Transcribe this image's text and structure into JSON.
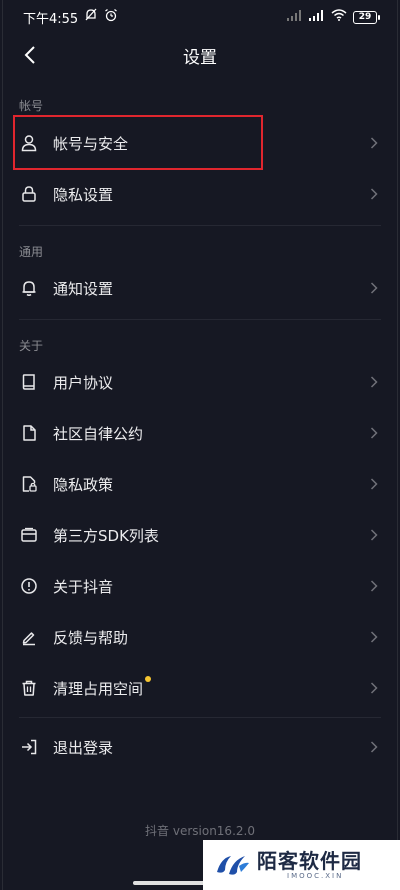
{
  "status_bar": {
    "time": "下午4:55",
    "battery": "29"
  },
  "nav": {
    "title": "设置"
  },
  "sections": {
    "account": {
      "header": "帐号",
      "items": [
        {
          "label": "帐号与安全"
        },
        {
          "label": "隐私设置"
        }
      ]
    },
    "general": {
      "header": "通用",
      "items": [
        {
          "label": "通知设置"
        }
      ]
    },
    "about": {
      "header": "关于",
      "items": [
        {
          "label": "用户协议"
        },
        {
          "label": "社区自律公约"
        },
        {
          "label": "隐私政策"
        },
        {
          "label": "第三方SDK列表"
        },
        {
          "label": "关于抖音"
        },
        {
          "label": "反馈与帮助"
        },
        {
          "label": "清理占用空间"
        }
      ]
    },
    "logout": {
      "items": [
        {
          "label": "退出登录"
        }
      ]
    }
  },
  "footer": {
    "version": "抖音 version16.2.0"
  },
  "watermark": {
    "title": "陌客软件园",
    "subtitle": "IMOOC.XIN"
  },
  "colors": {
    "background": "#161823",
    "highlight": "#e0262e",
    "badge_dot": "#f6c531"
  }
}
